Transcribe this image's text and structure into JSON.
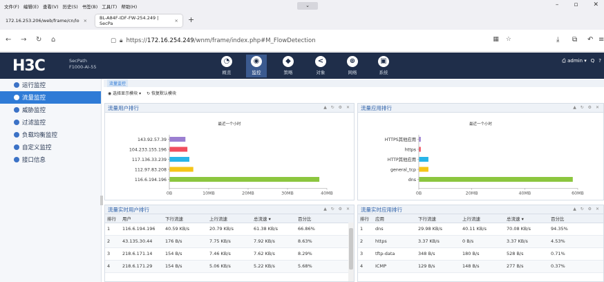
{
  "browser": {
    "menu": [
      "文件(F)",
      "编辑(E)",
      "查看(V)",
      "历史(S)",
      "书签(B)",
      "工具(T)",
      "帮助(H)"
    ],
    "tabs": [
      {
        "title": "172.16.253.206/web/frame/cn/lo",
        "close": "×"
      },
      {
        "title": "BL-A84F-IDF-FW-254.249 | SecPa",
        "close": "×"
      }
    ],
    "new_tab": "+",
    "url_prefix": "https://",
    "url_host": "172.16.254.249",
    "url_path": "/wnm/frame/index.php#M_FlowDetection"
  },
  "app": {
    "logo": "H3C",
    "model_line1": "SecPath",
    "model_line2": "F1000-AI-55",
    "nav": [
      {
        "label": "概览",
        "icon": "gauge-icon",
        "glyph": "◔"
      },
      {
        "label": "监控",
        "icon": "monitor-icon",
        "glyph": "◉"
      },
      {
        "label": "策略",
        "icon": "shield-icon",
        "glyph": "◆"
      },
      {
        "label": "对象",
        "icon": "share-icon",
        "glyph": "<"
      },
      {
        "label": "网络",
        "icon": "globe-icon",
        "glyph": "⊕"
      },
      {
        "label": "系统",
        "icon": "system-icon",
        "glyph": "▣"
      }
    ],
    "active_nav": 1,
    "user": "admin ▾",
    "search_icon": "Q",
    "help_icon": "?"
  },
  "sidebar": {
    "items": [
      {
        "label": "运行监控"
      },
      {
        "label": "流量监控"
      },
      {
        "label": "威胁监控"
      },
      {
        "label": "过滤监控"
      },
      {
        "label": "负载均衡监控"
      },
      {
        "label": "自定义监控"
      },
      {
        "label": "接口信息"
      }
    ],
    "active": 1
  },
  "main": {
    "breadcrumb": "流量监控",
    "select_modules": "选择显示模块",
    "restore_default": "恢复默认模块",
    "panel_controls": "▲ ↻ ⚙ ✕"
  },
  "panels": {
    "user_rank_title": "流量用户排行",
    "app_rank_title": "流量应用排行",
    "user_rt_title": "流量实时用户排行",
    "app_rt_title": "流量实时应用排行"
  },
  "chart_data": [
    {
      "type": "bar",
      "orientation": "horizontal",
      "title": "最近一个小时",
      "categories": [
        "143.92.57.39",
        "104.233.155.196",
        "117.136.33.239",
        "112.97.83.208",
        "116.6.194.196"
      ],
      "values": [
        4,
        4.5,
        5,
        6,
        38
      ],
      "colors": [
        "#9b7fd1",
        "#f04e5e",
        "#29b5e8",
        "#f5c518",
        "#8cc63f"
      ],
      "xlim": [
        0,
        40
      ],
      "ticks": [
        "0B",
        "10MB",
        "20MB",
        "30MB",
        "40MB"
      ]
    },
    {
      "type": "bar",
      "orientation": "horizontal",
      "title": "最近一个小时",
      "categories": [
        "HTTPS其他应用",
        "https",
        "HTTP其他应用",
        "general_tcp",
        "dns"
      ],
      "values": [
        0.6,
        0.6,
        3.5,
        3.5,
        58
      ],
      "colors": [
        "#9b7fd1",
        "#f04e5e",
        "#29b5e8",
        "#f5c518",
        "#8cc63f"
      ],
      "xlim": [
        0,
        60
      ],
      "ticks": [
        "0B",
        "20MB",
        "40MB",
        "60MB"
      ]
    }
  ],
  "user_table": {
    "headers": [
      "排行",
      "用户",
      "下行流速",
      "上行流速",
      "总流速 ▾",
      "百分比"
    ],
    "rows": [
      [
        "1",
        "116.6.194.196",
        "40.59 KB/s",
        "20.79 KB/s",
        "61.38 KB/s",
        "66.86%"
      ],
      [
        "2",
        "43.135.30.44",
        "176 B/s",
        "7.75 KB/s",
        "7.92 KB/s",
        "8.63%"
      ],
      [
        "3",
        "218.6.171.14",
        "154 B/s",
        "7.46 KB/s",
        "7.62 KB/s",
        "8.29%"
      ],
      [
        "4",
        "218.6.171.29",
        "154 B/s",
        "5.06 KB/s",
        "5.22 KB/s",
        "5.68%"
      ]
    ]
  },
  "app_table": {
    "headers": [
      "排行",
      "应用",
      "下行流速",
      "上行流速",
      "总流速 ▾",
      "百分比"
    ],
    "rows": [
      [
        "1",
        "dns",
        "29.98 KB/s",
        "40.11 KB/s",
        "70.08 KB/s",
        "94.35%"
      ],
      [
        "2",
        "https",
        "3.37 KB/s",
        "0 B/s",
        "3.37 KB/s",
        "4.53%"
      ],
      [
        "3",
        "tftp-data",
        "348 B/s",
        "180 B/s",
        "528 B/s",
        "0.71%"
      ],
      [
        "4",
        "ICMP",
        "129 B/s",
        "148 B/s",
        "277 B/s",
        "0.37%"
      ]
    ]
  }
}
